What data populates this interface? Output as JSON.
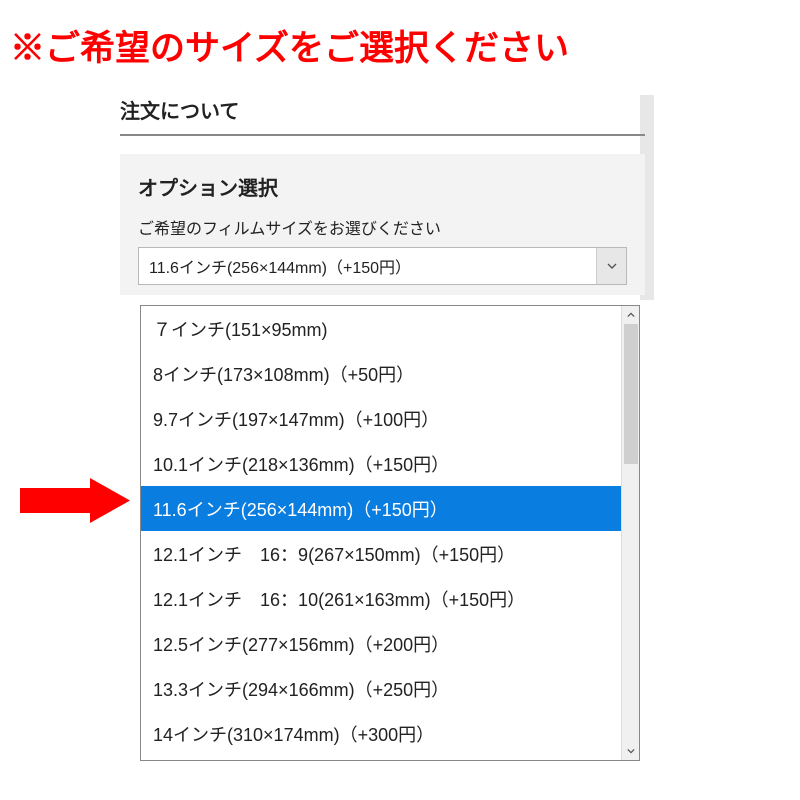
{
  "instruction": "※ご希望のサイズをご選択ください",
  "section_title": "注文について",
  "option": {
    "heading": "オプション選択",
    "sub": "ご希望のフィルムサイズをお選びください",
    "selected": "11.6インチ(256×144mm)（+150円）"
  },
  "options": [
    {
      "label": "７インチ(151×95mm)",
      "selected": false
    },
    {
      "label": "8インチ(173×108mm)（+50円）",
      "selected": false
    },
    {
      "label": "9.7インチ(197×147mm)（+100円）",
      "selected": false
    },
    {
      "label": "10.1インチ(218×136mm)（+150円）",
      "selected": false
    },
    {
      "label": "11.6インチ(256×144mm)（+150円）",
      "selected": true
    },
    {
      "label": "12.1インチ　16：9(267×150mm)（+150円）",
      "selected": false
    },
    {
      "label": "12.1インチ　16：10(261×163mm)（+150円）",
      "selected": false
    },
    {
      "label": "12.5インチ(277×156mm)（+200円）",
      "selected": false
    },
    {
      "label": "13.3インチ(294×166mm)（+250円）",
      "selected": false
    },
    {
      "label": "14インチ(310×174mm)（+300円）",
      "selected": false
    }
  ],
  "colors": {
    "accent_red": "#ff0000",
    "select_blue": "#0a7de0"
  }
}
